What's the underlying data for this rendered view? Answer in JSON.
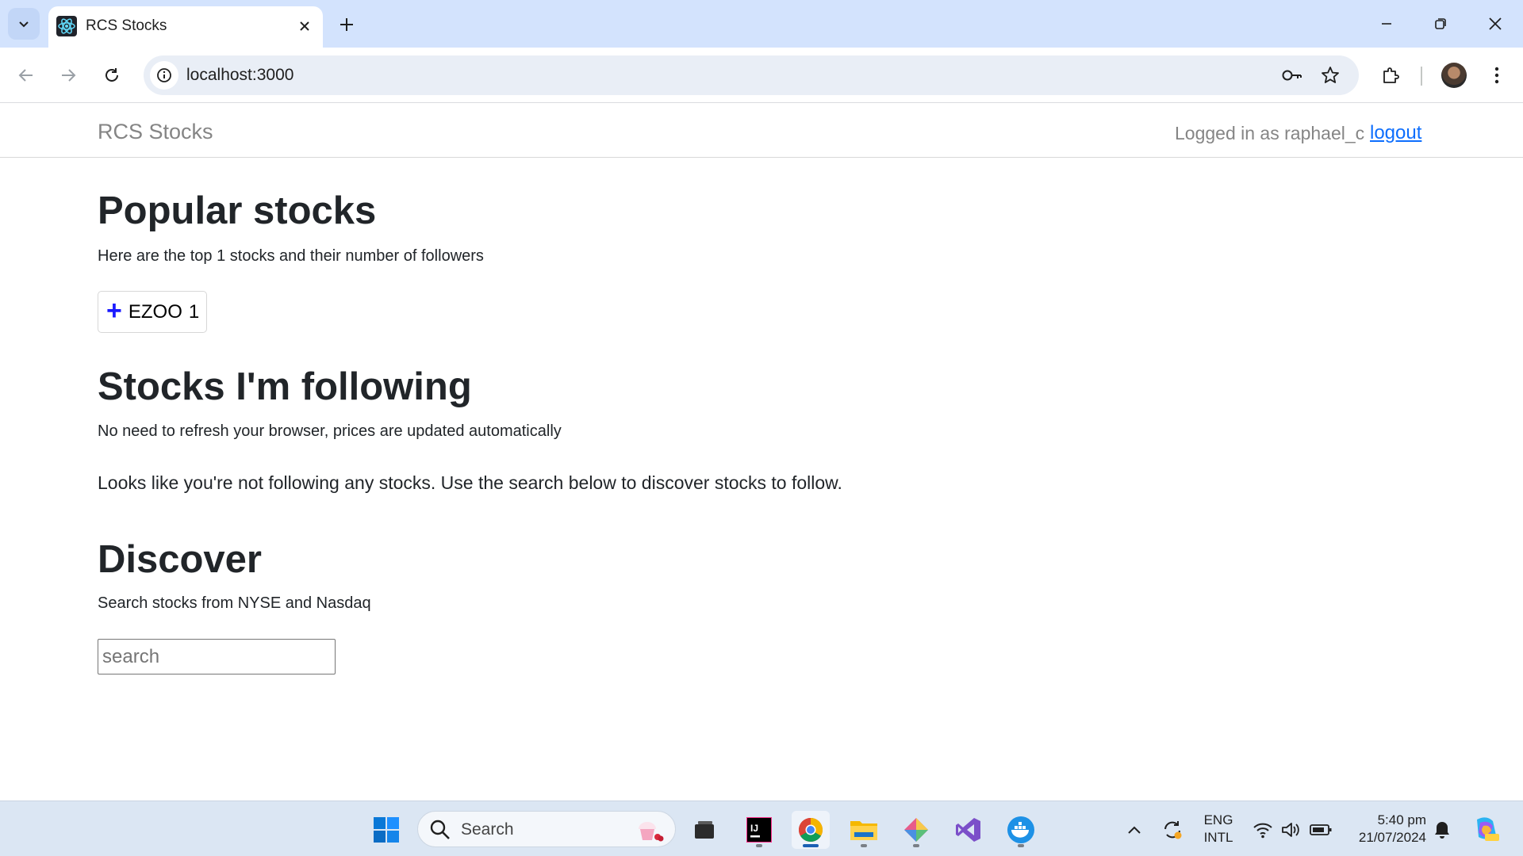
{
  "browser": {
    "tab_title": "RCS Stocks",
    "url": "localhost:3000"
  },
  "navbar": {
    "brand": "RCS Stocks",
    "logged_in_text": "Logged in as raphael_c",
    "logout_label": "logout"
  },
  "popular": {
    "heading": "Popular stocks",
    "subtitle": "Here are the top 1 stocks and their number of followers",
    "stocks": [
      {
        "symbol": "EZOO",
        "followers": "1"
      }
    ]
  },
  "following": {
    "heading": "Stocks I'm following",
    "subtitle": "No need to refresh your browser, prices are updated automatically",
    "empty_message": "Looks like you're not following any stocks. Use the search below to discover stocks to follow."
  },
  "discover": {
    "heading": "Discover",
    "subtitle": "Search stocks from NYSE and Nasdaq",
    "search_placeholder": "search"
  },
  "taskbar": {
    "search_label": "Search",
    "language_line1": "ENG",
    "language_line2": "INTL",
    "time": "5:40 pm",
    "date": "21/07/2024"
  }
}
